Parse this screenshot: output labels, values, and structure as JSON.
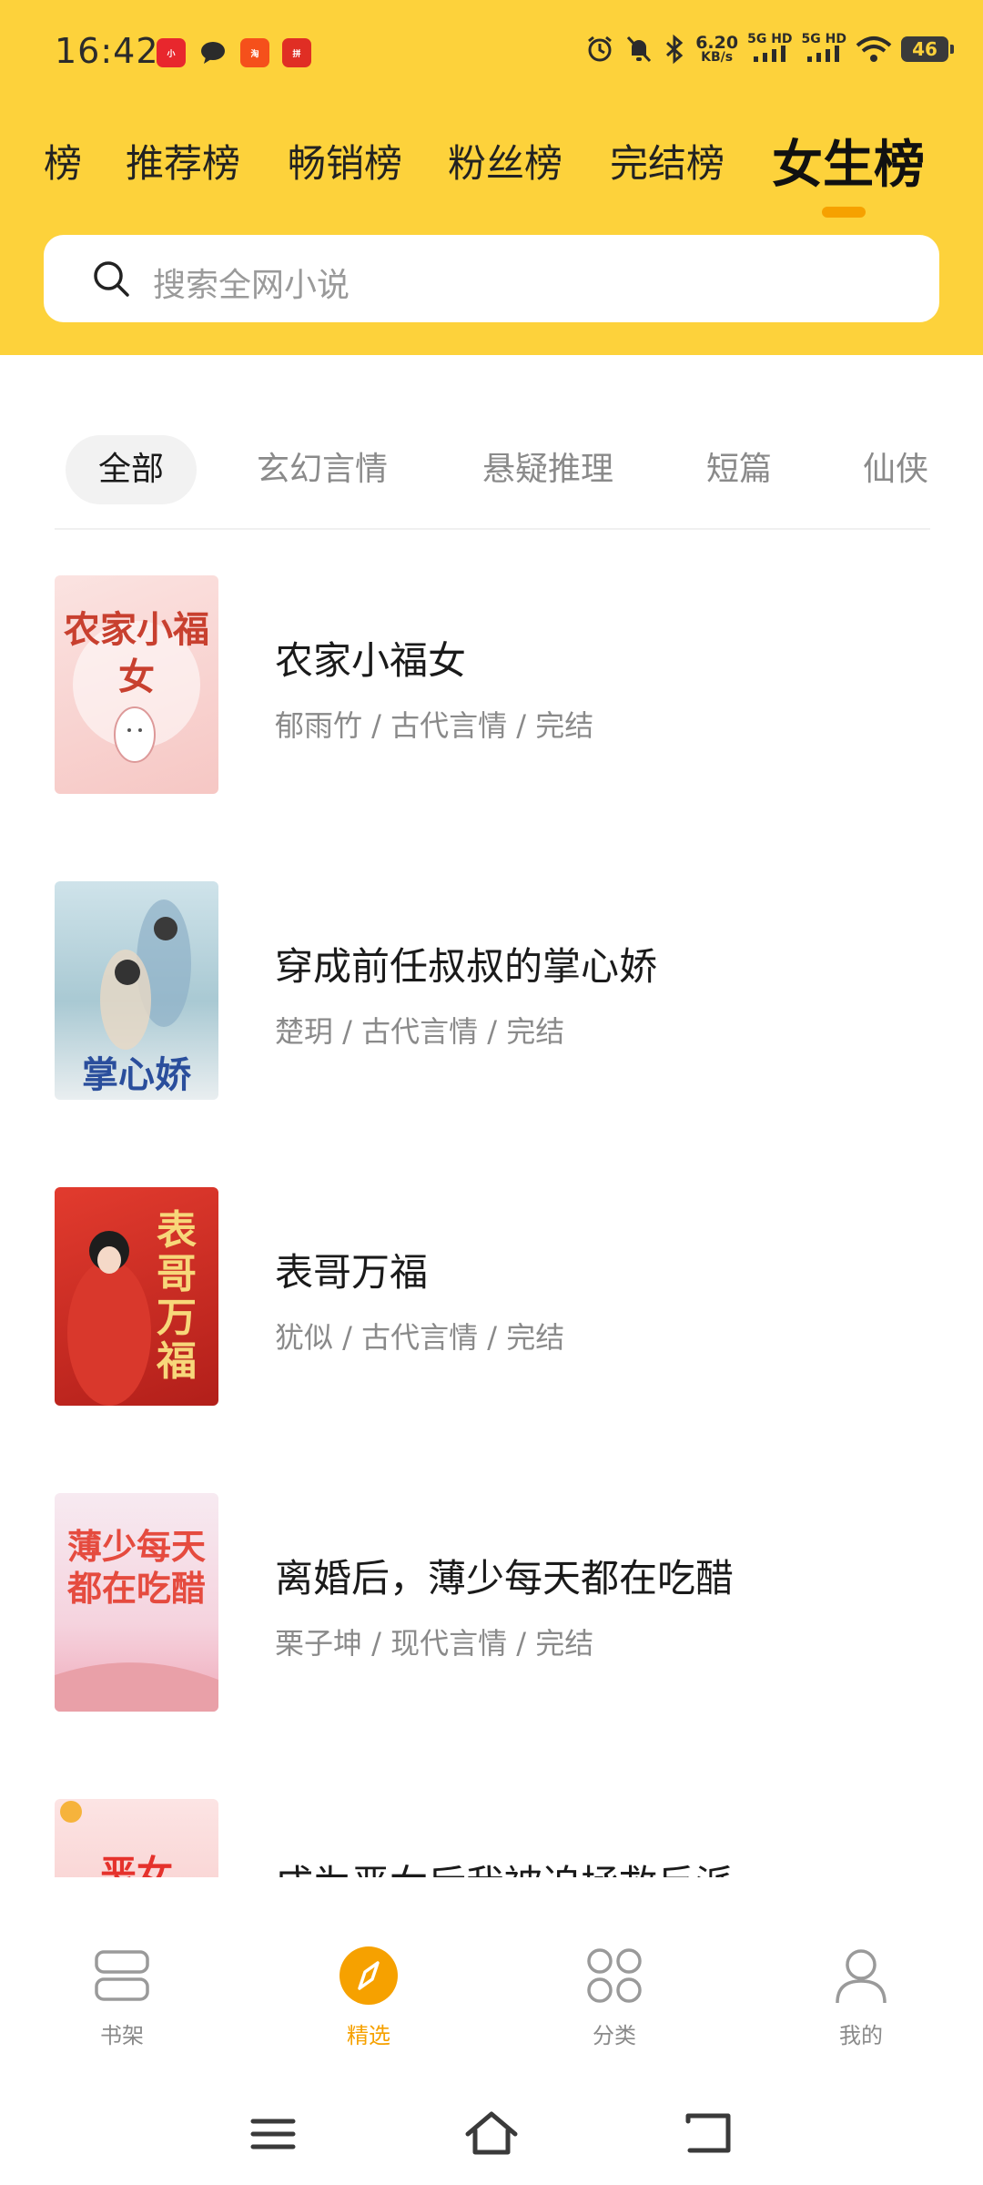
{
  "status_bar": {
    "time": "16:42",
    "net_speed_value": "6.20",
    "net_speed_unit": "KB/s",
    "sim1": "5G HD",
    "sim2": "5G HD",
    "battery": "46",
    "notification_icons": [
      "xiaohongshu-icon",
      "message-icon",
      "taobao-icon",
      "pinduoduo-icon"
    ]
  },
  "rank_tabs": [
    {
      "label": "榜"
    },
    {
      "label": "推荐榜"
    },
    {
      "label": "畅销榜"
    },
    {
      "label": "粉丝榜"
    },
    {
      "label": "完结榜"
    },
    {
      "label": "女生榜",
      "active": true
    }
  ],
  "search": {
    "placeholder": "搜索全网小说"
  },
  "categories": [
    {
      "label": "全部",
      "active": true
    },
    {
      "label": "玄幻言情"
    },
    {
      "label": "悬疑推理"
    },
    {
      "label": "短篇"
    },
    {
      "label": "仙侠"
    }
  ],
  "books": [
    {
      "title": "农家小福女",
      "meta": "郁雨竹 / 古代言情 / 完结",
      "cover_text": "农家小福女"
    },
    {
      "title": "穿成前任叔叔的掌心娇",
      "meta": "楚玥 / 古代言情 / 完结",
      "cover_text": "掌心娇"
    },
    {
      "title": "表哥万福",
      "meta": "犹似 / 古代言情 / 完结",
      "cover_text": "表哥万福"
    },
    {
      "title": "离婚后，薄少每天都在吃醋",
      "meta": "栗子坤 / 现代言情 / 完结",
      "cover_text": "薄少每天都在吃醋"
    },
    {
      "title": "成为恶女后我被迫拯救反派",
      "meta": "",
      "cover_text": "恶女"
    }
  ],
  "bottom_nav": [
    {
      "label": "书架",
      "icon": "bookshelf-icon"
    },
    {
      "label": "精选",
      "icon": "compass-icon",
      "active": true
    },
    {
      "label": "分类",
      "icon": "grid-icon"
    },
    {
      "label": "我的",
      "icon": "profile-icon"
    }
  ],
  "colors": {
    "accent_yellow": "#FDD23B",
    "active_orange": "#F6A100"
  }
}
